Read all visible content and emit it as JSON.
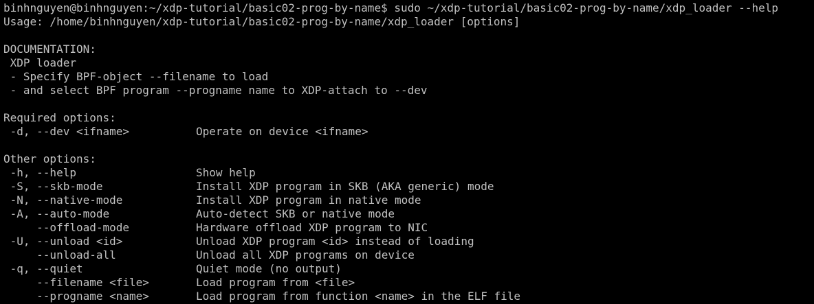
{
  "terminal": {
    "text_color": "#c0c0c0",
    "background_color": "#000000",
    "prompt": "binhnguyen@binhnguyen:~/xdp-tutorial/basic02-prog-by-name$ ",
    "command": "sudo ~/xdp-tutorial/basic02-prog-by-name/xdp_loader --help",
    "usage": "Usage: /home/binhnguyen/xdp-tutorial/basic02-prog-by-name/xdp_loader [options]",
    "documentation_header": "DOCUMENTATION:",
    "documentation_lines": [
      " XDP loader",
      " - Specify BPF-object --filename to load",
      " - and select BPF program --progname name to XDP-attach to --dev"
    ],
    "required_header": "Required options:",
    "required_options": [
      {
        "flag": " -d, --dev <ifname>",
        "description": "Operate on device <ifname>"
      }
    ],
    "other_header": "Other options:",
    "other_options": [
      {
        "flag": " -h, --help",
        "description": "Show help"
      },
      {
        "flag": " -S, --skb-mode",
        "description": "Install XDP program in SKB (AKA generic) mode"
      },
      {
        "flag": " -N, --native-mode",
        "description": "Install XDP program in native mode"
      },
      {
        "flag": " -A, --auto-mode",
        "description": "Auto-detect SKB or native mode"
      },
      {
        "flag": "     --offload-mode",
        "description": "Hardware offload XDP program to NIC"
      },
      {
        "flag": " -U, --unload <id>",
        "description": "Unload XDP program <id> instead of loading"
      },
      {
        "flag": "     --unload-all",
        "description": "Unload all XDP programs on device"
      },
      {
        "flag": " -q, --quiet",
        "description": "Quiet mode (no output)"
      },
      {
        "flag": "     --filename <file>",
        "description": "Load program from <file>"
      },
      {
        "flag": "     --progname <name>",
        "description": "Load program from function <name> in the ELF file"
      }
    ]
  }
}
